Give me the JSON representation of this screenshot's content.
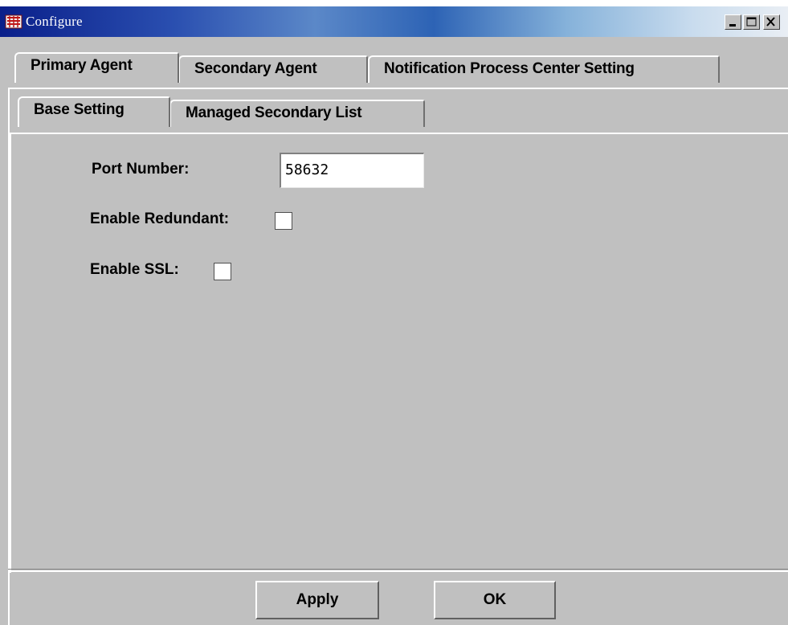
{
  "window": {
    "title": "Configure",
    "app_icon": "app-logo-icon",
    "controls": {
      "minimize": "minimize-icon",
      "maximize": "maximize-icon",
      "close": "close-icon"
    }
  },
  "outer_tabs": [
    {
      "label": "Primary Agent",
      "selected": true
    },
    {
      "label": "Secondary Agent",
      "selected": false
    },
    {
      "label": "Notification Process Center Setting",
      "selected": false
    }
  ],
  "inner_tabs": [
    {
      "label": "Base Setting",
      "selected": true
    },
    {
      "label": "Managed Secondary List",
      "selected": false
    }
  ],
  "form": {
    "port_label": "Port Number:",
    "port_value": "58632",
    "redundant_label": "Enable Redundant:",
    "redundant_checked": false,
    "ssl_label": "Enable SSL:",
    "ssl_checked": false
  },
  "buttons": {
    "apply": "Apply",
    "ok": "OK"
  },
  "colors": {
    "face": "#c0c0c0",
    "title_start": "#0a1f8a",
    "title_end": "#e9eef4"
  }
}
